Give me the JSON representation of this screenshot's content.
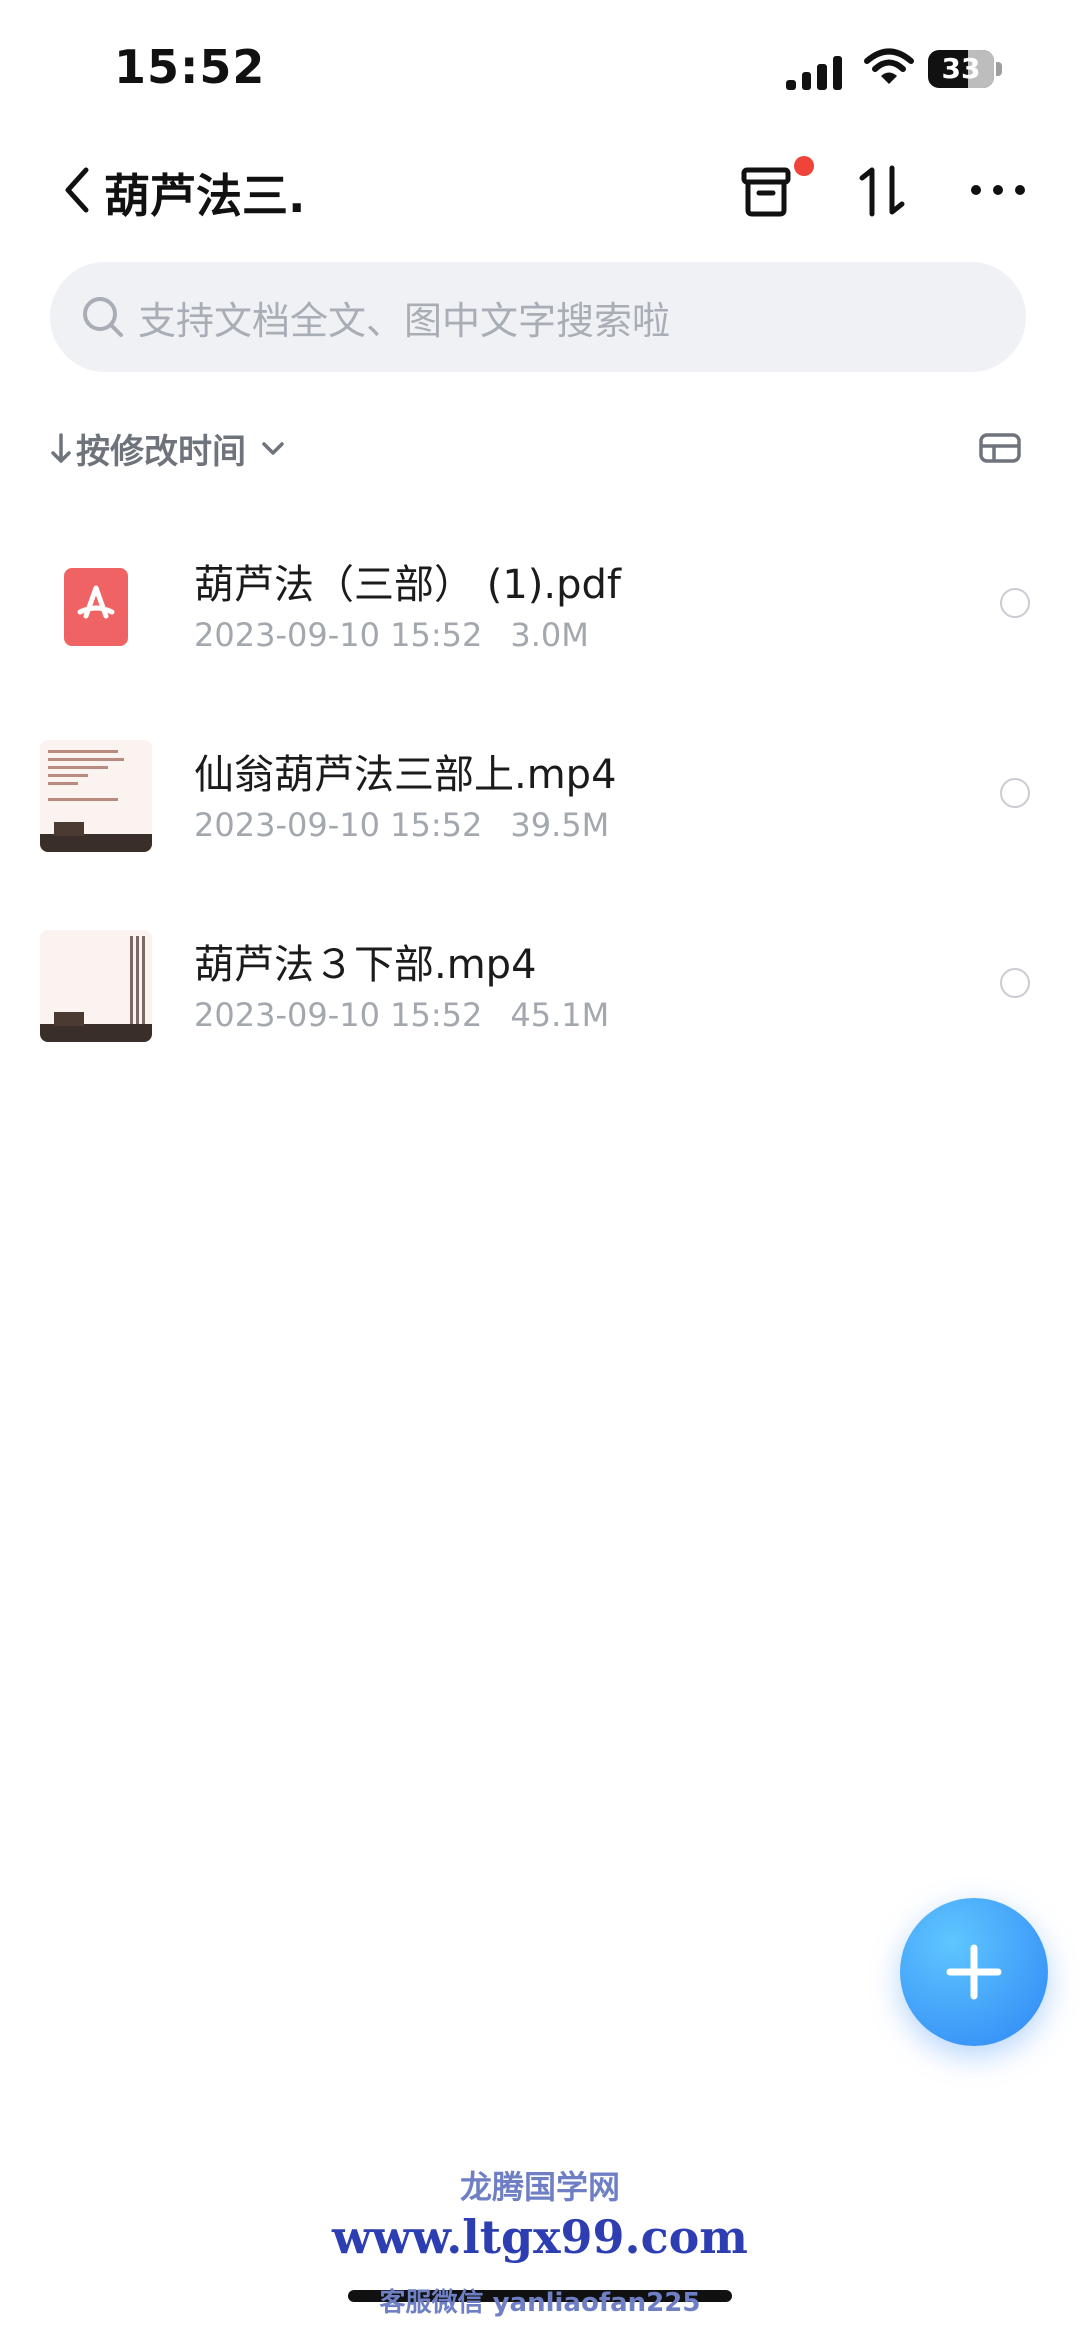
{
  "status_bar": {
    "time": "15:52",
    "battery": "33"
  },
  "header": {
    "title": "葫芦法三."
  },
  "search": {
    "placeholder": "支持文档全文、图中文字搜索啦"
  },
  "sort": {
    "label": "按修改时间"
  },
  "files": [
    {
      "name": "葫芦法（三部） (1).pdf",
      "date": "2023-09-10 15:52",
      "size": "3.0M",
      "kind": "pdf"
    },
    {
      "name": "仙翁葫芦法三部上.mp4",
      "date": "2023-09-10 15:52",
      "size": "39.5M",
      "kind": "video"
    },
    {
      "name": "葫芦法３下部.mp4",
      "date": "2023-09-10 15:52",
      "size": "45.1M",
      "kind": "video"
    }
  ],
  "watermark": {
    "line1": "龙腾国学网",
    "line2": "www.ltgx99.com",
    "line3": "客服微信 yanliaofan225"
  },
  "colors": {
    "accent": "#2e86f5",
    "pdf_red": "#f06365",
    "badge_red": "#f0443a"
  }
}
